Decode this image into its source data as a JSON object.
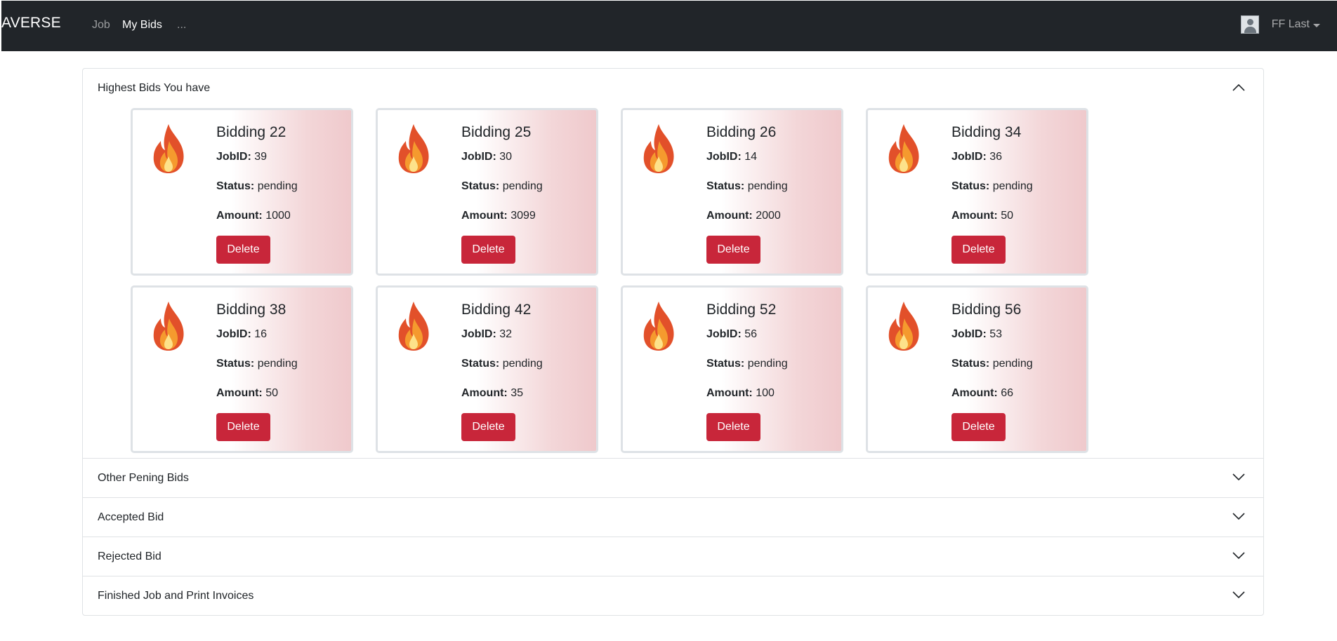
{
  "navbar": {
    "brand": "AVERSE",
    "links": [
      "Job",
      "My Bids",
      "..."
    ],
    "user_name": "FF Last"
  },
  "accordion": {
    "sections": [
      {
        "title": "Highest Bids You have",
        "expanded": true
      },
      {
        "title": "Other Pening Bids",
        "expanded": false
      },
      {
        "title": "Accepted Bid",
        "expanded": false
      },
      {
        "title": "Rejected Bid",
        "expanded": false
      },
      {
        "title": "Finished Job and Print Invoices",
        "expanded": false
      }
    ]
  },
  "labels": {
    "jobid": "JobID:",
    "status": "Status:",
    "amount": "Amount:",
    "delete": "Delete"
  },
  "bids": [
    {
      "title": "Bidding 22",
      "jobid": "39",
      "status": "pending",
      "amount": "1000"
    },
    {
      "title": "Bidding 25",
      "jobid": "30",
      "status": "pending",
      "amount": "3099"
    },
    {
      "title": "Bidding 26",
      "jobid": "14",
      "status": "pending",
      "amount": "2000"
    },
    {
      "title": "Bidding 34",
      "jobid": "36",
      "status": "pending",
      "amount": "50"
    },
    {
      "title": "Bidding 38",
      "jobid": "16",
      "status": "pending",
      "amount": "50"
    },
    {
      "title": "Bidding 42",
      "jobid": "32",
      "status": "pending",
      "amount": "35"
    },
    {
      "title": "Bidding 52",
      "jobid": "56",
      "status": "pending",
      "amount": "100"
    },
    {
      "title": "Bidding 56",
      "jobid": "53",
      "status": "pending",
      "amount": "66"
    }
  ],
  "colors": {
    "navbar": "#212529",
    "danger": "#c8263a",
    "card_gradient_end": "#efc9cc"
  },
  "icons": {
    "bid_card": "fire-icon",
    "section_toggle": "chevron-down-icon",
    "user": "avatar"
  }
}
